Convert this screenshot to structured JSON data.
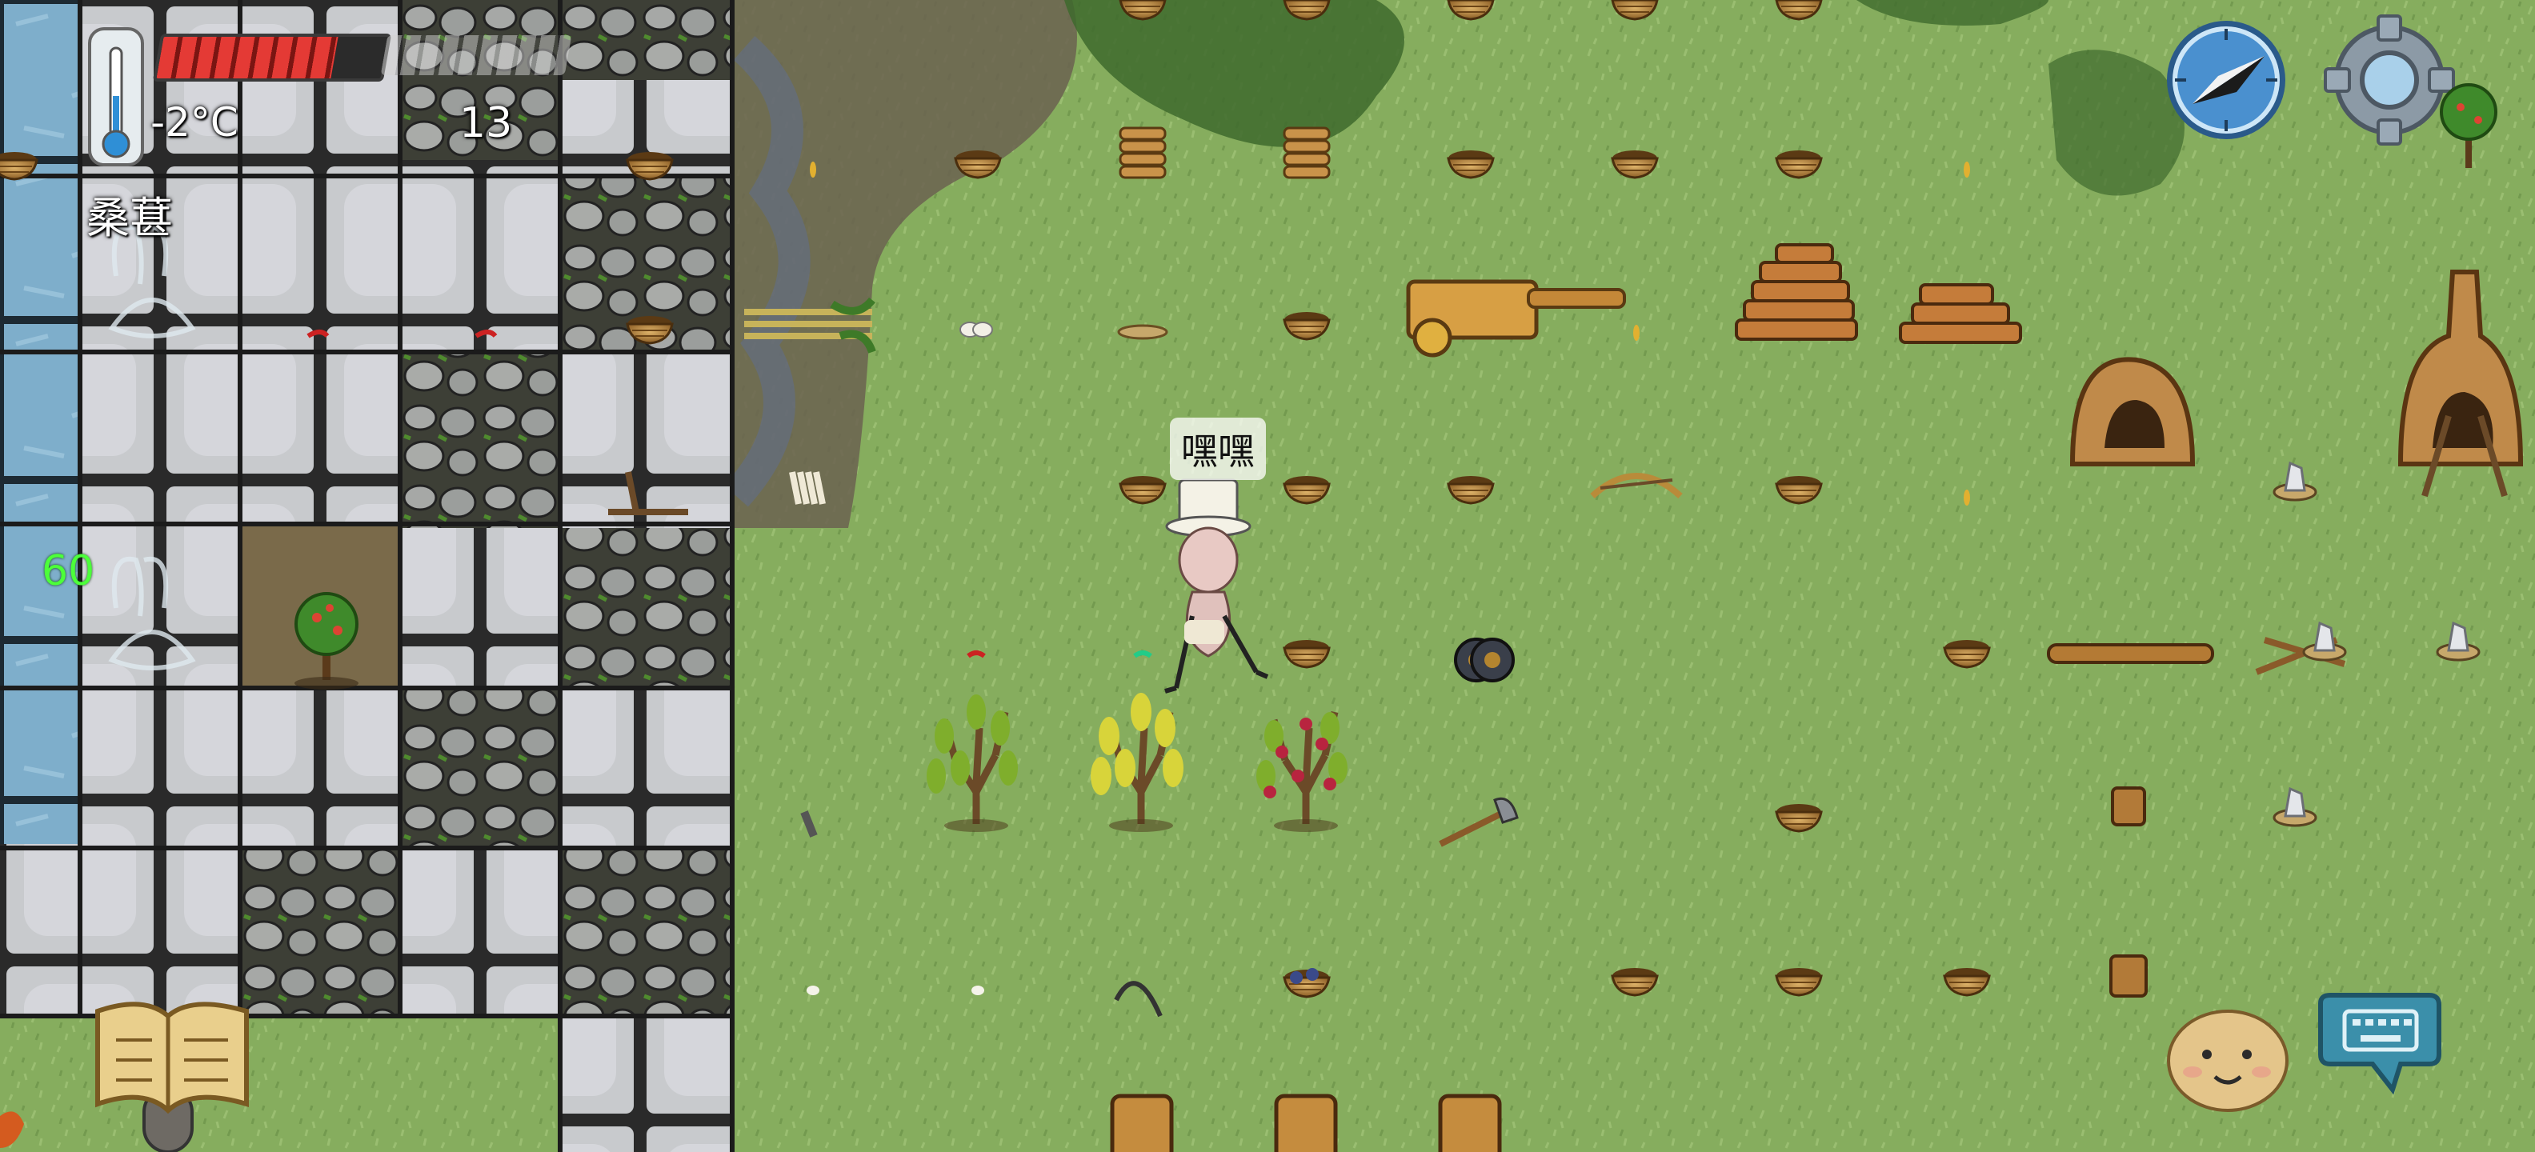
{
  "hud": {
    "temperature": "-2°C",
    "hunger_fraction": 0.78,
    "food_count": "13",
    "hovered_object": "桑葚",
    "age": "60"
  },
  "player": {
    "speech": "嘿嘿"
  },
  "colors": {
    "grass": "#7fa85a",
    "ice_tile": "#7fb0cc",
    "stone_floor": "#c9cbd0",
    "cobble": "#8e9194",
    "mud": "#6c5f4a",
    "hunger_red": "#e43a35",
    "age_green": "#4cff3a"
  },
  "icons": [
    "thermometer-icon",
    "compass-icon",
    "gear-icon",
    "recipe-book-icon",
    "emote-face-icon",
    "keyboard-chat-icon"
  ]
}
